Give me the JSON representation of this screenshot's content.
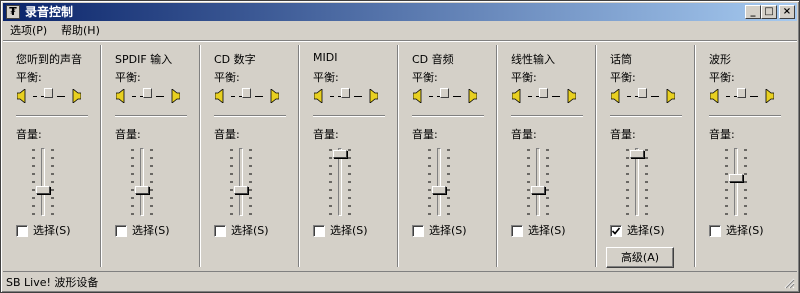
{
  "window": {
    "title": "录音控制",
    "app_icon_glyph": "₮",
    "buttons": {
      "minimize": "_",
      "maximize": "□",
      "close": "×"
    }
  },
  "menu": [
    {
      "label": "选项(P)"
    },
    {
      "label": "帮助(H)"
    }
  ],
  "labels": {
    "balance": "平衡:",
    "volume": "音量:",
    "select": "选择(S)"
  },
  "channels": [
    {
      "name": "您听到的声音",
      "balance": 0.5,
      "volume": 0.4,
      "selected": false
    },
    {
      "name": "SPDIF 输入",
      "balance": 0.5,
      "volume": 0.4,
      "selected": false
    },
    {
      "name": "CD 数字",
      "balance": 0.5,
      "volume": 0.4,
      "selected": false
    },
    {
      "name": "MIDI",
      "balance": 0.5,
      "volume": 1.0,
      "selected": false
    },
    {
      "name": "CD 音频",
      "balance": 0.5,
      "volume": 0.4,
      "selected": false
    },
    {
      "name": "线性输入",
      "balance": 0.5,
      "volume": 0.4,
      "selected": false
    },
    {
      "name": "话筒",
      "balance": 0.5,
      "volume": 1.0,
      "selected": true,
      "advanced": "高级(A)"
    },
    {
      "name": "波形",
      "balance": 0.5,
      "volume": 0.6,
      "selected": false
    }
  ],
  "status": {
    "text": "SB Live! 波形设备"
  },
  "icons": {
    "speaker_left": "speaker-left-icon",
    "speaker_right": "speaker-right-icon",
    "checkmark": "checkmark-icon"
  },
  "colors": {
    "face": "#d4d0c8",
    "title_start": "#0a246a",
    "title_end": "#a6caf0",
    "speaker": "#e8d020"
  }
}
